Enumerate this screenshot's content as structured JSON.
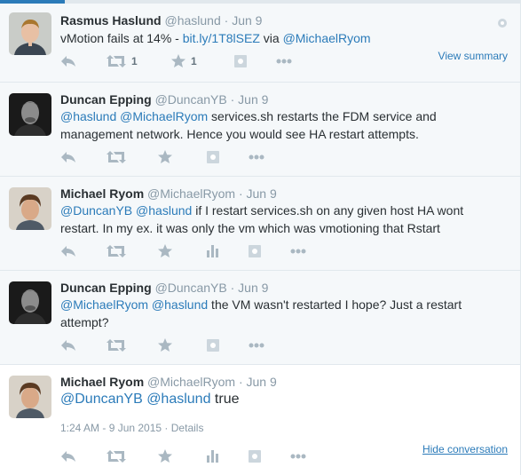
{
  "tweets": [
    {
      "fullname": "Rasmus Haslund",
      "handle": "@haslund",
      "time": "Jun 9",
      "text_plain": "vMotion fails at 14% - ",
      "link1": "bit.ly/1T8lSEZ",
      "text_mid": " via ",
      "link2": "@MichaelRyom",
      "retweet_count": "1",
      "favorite_count": "1",
      "view_summary": "View summary"
    },
    {
      "fullname": "Duncan Epping",
      "handle": "@DuncanYB",
      "time": "Jun 9",
      "mention1": "@haslund",
      "mention2": "@MichaelRyom",
      "text": " services.sh restarts the FDM service and management network. Hence you would see HA restart attempts."
    },
    {
      "fullname": "Michael Ryom",
      "handle": "@MichaelRyom",
      "time": "Jun 9",
      "mention1": "@DuncanYB",
      "mention2": "@haslund",
      "text": " if I restart services.sh on any given host HA wont restart. In my ex. it was only the vm which was vmotioning that Rstart"
    },
    {
      "fullname": "Duncan Epping",
      "handle": "@DuncanYB",
      "time": "Jun 9",
      "mention1": "@MichaelRyom",
      "mention2": "@haslund",
      "text": " the VM wasn't restarted I hope? Just a restart attempt?"
    },
    {
      "fullname": "Michael Ryom",
      "handle": "@MichaelRyom",
      "time": "Jun 9",
      "mention1": "@DuncanYB",
      "mention2": "@haslund",
      "text": " true",
      "timestamp": "1:24 AM - 9 Jun 2015",
      "details": "Details",
      "hide_conversation": "Hide conversation"
    }
  ],
  "separator": "·",
  "icons": {
    "reply": "reply-icon",
    "retweet": "retweet-icon",
    "favorite": "star-icon",
    "analytics": "bar-chart-icon",
    "media": "photo-icon",
    "more": "more-dots-icon",
    "settings": "gear-icon"
  },
  "colors": {
    "link": "#2b7bb9",
    "muted": "#8899a6",
    "icon": "#aab8c2",
    "text": "#292f33"
  }
}
